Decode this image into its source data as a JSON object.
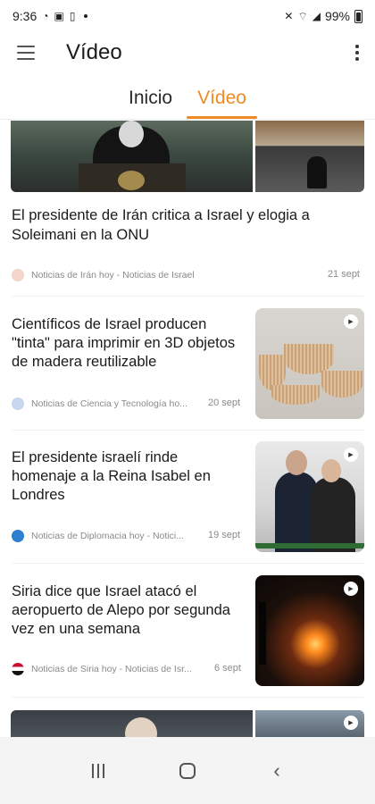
{
  "status_bar": {
    "time": "9:36",
    "battery": "99%"
  },
  "app_bar": {
    "title": "Vídeo"
  },
  "tabs": [
    {
      "label": "Inicio",
      "active": false
    },
    {
      "label": "Vídeo",
      "active": true
    }
  ],
  "accent_color": "#f08a24",
  "feed": {
    "featured": {
      "title": "El presidente de Irán critica a Israel y elogia a Soleimani en la ONU",
      "source": "Noticias de Irán hoy - Noticias de Israel",
      "date": "21 sept"
    },
    "items": [
      {
        "title": "Científicos de Israel producen \"tinta\" para imprimir en 3D objetos de madera reutilizable",
        "source": "Noticias de Ciencia y Tecnología ho...",
        "date": "20 sept",
        "has_video": true
      },
      {
        "title": "El presidente israelí rinde homenaje a la Reina Isabel en Londres",
        "source": "Noticias de Diplomacia hoy - Notici...",
        "date": "19 sept",
        "has_video": true
      },
      {
        "title": "Siria dice que Israel atacó el aeropuerto de Alepo por segunda vez en una semana",
        "source": "Noticias de Siria hoy - Noticias de Isr...",
        "date": "6 sept",
        "has_video": true
      }
    ]
  }
}
